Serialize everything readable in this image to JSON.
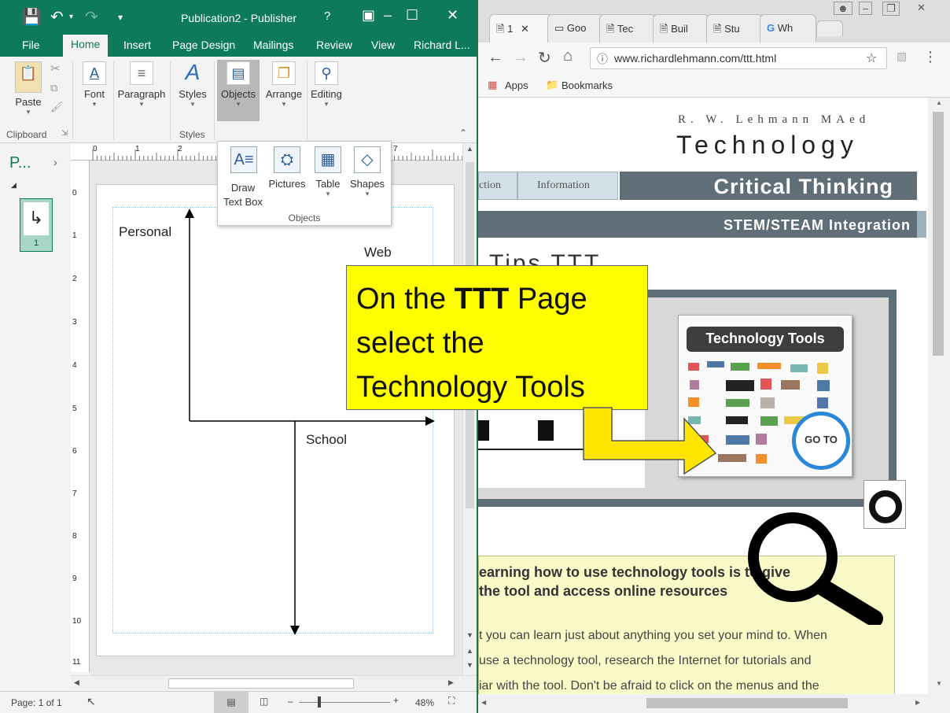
{
  "publisher": {
    "title": "Publication2 - Publisher",
    "help": "?",
    "tabs": [
      "File",
      "Home",
      "Insert",
      "Page Design",
      "Mailings",
      "Review",
      "View",
      "Richard L..."
    ],
    "ribbon": {
      "paste": "Paste",
      "font": "Font",
      "paragraph": "Paragraph",
      "styles": "Styles",
      "objects": "Objects",
      "arrange": "Arrange",
      "editing": "Editing",
      "group_clipboard": "Clipboard",
      "group_styles": "Styles"
    },
    "objects_menu": {
      "items": [
        "Draw Text Box",
        "Pictures",
        "Table",
        "Shapes"
      ],
      "label": "Objects"
    },
    "pages_pane": {
      "title": "P...",
      "page_number": "1"
    },
    "ruler_h": [
      "0",
      "1",
      "2",
      "7"
    ],
    "ruler_v": [
      "0",
      "1",
      "2",
      "3",
      "4",
      "5",
      "6",
      "7",
      "8",
      "9",
      "10",
      "11"
    ],
    "diagram": {
      "label_personal": "Personal",
      "label_web": "Web",
      "label_school": "School"
    },
    "status": {
      "page": "Page: 1 of 1",
      "zoom": "48%"
    }
  },
  "chrome": {
    "tabs": [
      "1",
      "Goo",
      "Tec",
      "Buil",
      "Stu",
      "Wh"
    ],
    "url": "www.richardlehmann.com/ttt.html",
    "bookmarks": {
      "apps": "Apps",
      "bookmarks": "Bookmarks"
    },
    "page": {
      "author": "R. W. Lehmann MAed",
      "site_title": "Technology",
      "nav_fragment": "ction",
      "nav_information": "Information",
      "banner": "Critical Thinking",
      "subbanner": "STEM/STEAM Integration",
      "heading_fragment": "Tips TTT",
      "tools_label": "Technology Tools",
      "goto": "GO TO",
      "para_bold_1": "earning how to use technology tools is to give",
      "para_bold_2": "the tool and access online resources",
      "para_1": "t you can learn just about anything you set your mind to. When",
      "para_2": "use a technology tool, research the Internet for tutorials and",
      "para_3": "iar with the tool. Don't be afraid to click on the menus and the"
    }
  },
  "callout": {
    "part1": "On the ",
    "bold": "TTT",
    "part2": " Page",
    "line2": "select the",
    "line3": "Technology Tools"
  },
  "colors": {
    "publisher_green": "#0e7a5c",
    "callout_yellow": "#fffe00",
    "banner_slate": "#5f6e77",
    "goto_ring": "#2b88d8"
  }
}
